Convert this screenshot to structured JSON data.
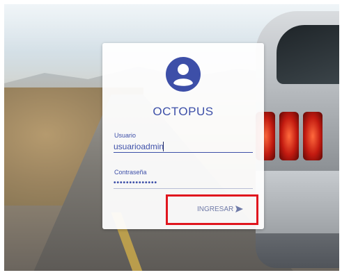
{
  "app": {
    "brand": "OCTOPUS"
  },
  "login": {
    "username_label": "Usuario",
    "username_value": "usuarioadmin",
    "password_label": "Contraseña",
    "password_value": "••••••••••••••",
    "submit_label": "INGRESAR"
  },
  "icons": {
    "avatar": "user-avatar-icon",
    "submit": "send-arrow-icon"
  },
  "colors": {
    "accent": "#3d4fa8",
    "highlight_box": "#e0161e"
  }
}
